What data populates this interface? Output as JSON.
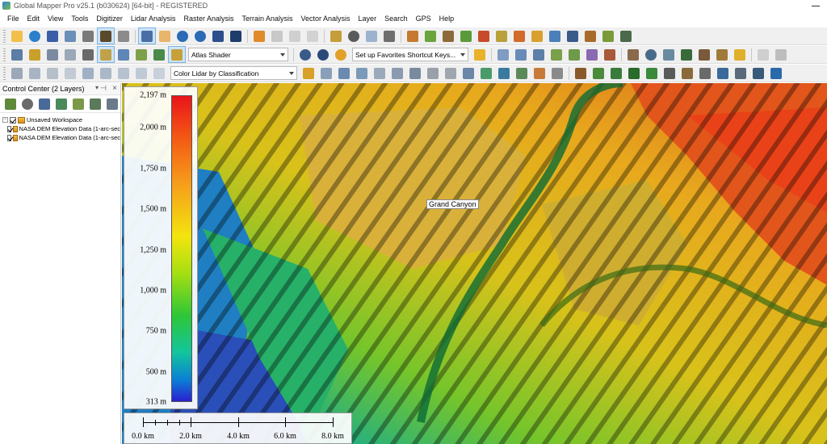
{
  "window": {
    "title": "Global Mapper Pro v25.1 (b030624) [64-bit] - REGISTERED"
  },
  "menu": {
    "items": [
      "File",
      "Edit",
      "View",
      "Tools",
      "Digitizer",
      "Lidar Analysis",
      "Raster Analysis",
      "Terrain Analysis",
      "Vector Analysis",
      "Layer",
      "Search",
      "GPS",
      "Help"
    ]
  },
  "toolbar2": {
    "shader_select": "Atlas Shader",
    "favorites_select": "Set up Favorites Shortcut Keys..."
  },
  "toolbar3": {
    "lidar_color_select": "Color Lidar by Classification"
  },
  "control_center": {
    "title": "Control Center (2 Layers)",
    "workspace": "Unsaved Workspace",
    "layers": [
      {
        "label": "NASA DEM Elevation Data (1-arc-sec"
      },
      {
        "label": "NASA DEM Elevation Data (1-arc-sec"
      }
    ]
  },
  "map": {
    "place_label": "Grand Canyon",
    "legend": {
      "labels": [
        "2,197 m",
        "2,000 m",
        "1,750 m",
        "1,500 m",
        "1,250 m",
        "1,000 m",
        "750 m",
        "500 m",
        "313 m"
      ],
      "colors": [
        "#e8141a",
        "#f45a14",
        "#f6a31a",
        "#f3e40e",
        "#a6df11",
        "#2dc637",
        "#12c59d",
        "#0b7fd5",
        "#2b20d0"
      ]
    },
    "scale": {
      "labels": [
        "0.0 km",
        "2.0 km",
        "4.0 km",
        "6.0 km",
        "8.0 km"
      ]
    }
  }
}
